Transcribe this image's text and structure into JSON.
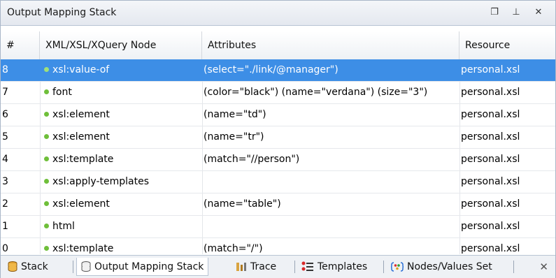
{
  "panel": {
    "title": "Output Mapping Stack",
    "restore_glyph": "❐",
    "pin_glyph": "⊥",
    "close_glyph": "✕"
  },
  "table": {
    "columns": [
      "#",
      "XML/XSL/XQuery Node",
      "Attributes",
      "Resource"
    ],
    "rows": [
      {
        "num": "8",
        "node": "xsl:value-of",
        "attrs": "(select=\"./link/@manager\")",
        "resource": "personal.xsl",
        "selected": true
      },
      {
        "num": "7",
        "node": "font",
        "attrs": "(color=\"black\") (name=\"verdana\") (size=\"3\")",
        "resource": "personal.xsl"
      },
      {
        "num": "6",
        "node": "xsl:element",
        "attrs": "(name=\"td\")",
        "resource": "personal.xsl"
      },
      {
        "num": "5",
        "node": "xsl:element",
        "attrs": "(name=\"tr\")",
        "resource": "personal.xsl"
      },
      {
        "num": "4",
        "node": "xsl:template",
        "attrs": "(match=\"//person\")",
        "resource": "personal.xsl"
      },
      {
        "num": "3",
        "node": "xsl:apply-templates",
        "attrs": "",
        "resource": "personal.xsl"
      },
      {
        "num": "2",
        "node": "xsl:element",
        "attrs": "(name=\"table\")",
        "resource": "personal.xsl"
      },
      {
        "num": "1",
        "node": "html",
        "attrs": "",
        "resource": "personal.xsl"
      },
      {
        "num": "0",
        "node": "xsl:template",
        "attrs": "(match=\"/\")",
        "resource": "personal.xsl"
      }
    ]
  },
  "tabs": [
    {
      "label": "Stack",
      "icon": "stack-icon"
    },
    {
      "label": "Output Mapping Stack",
      "icon": "output-mapping-stack-icon",
      "active": true
    },
    {
      "label": "Trace",
      "icon": "trace-icon"
    },
    {
      "label": "Templates",
      "icon": "templates-icon"
    },
    {
      "label": "Nodes/Values Set",
      "icon": "nodes-values-set-icon"
    }
  ],
  "tabbar_close_glyph": "✕",
  "colors": {
    "selection": "#3d8ee6",
    "node_dot": "#6fbf3a"
  }
}
